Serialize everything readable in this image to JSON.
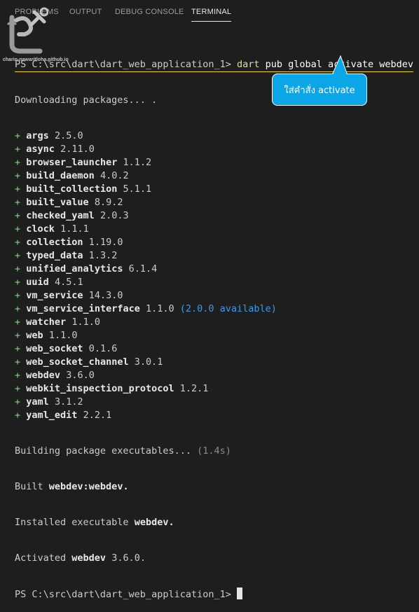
{
  "tabs": [
    {
      "label": "PROBLEMS"
    },
    {
      "label": "OUTPUT"
    },
    {
      "label": "DEBUG CONSOLE"
    },
    {
      "label": "TERMINAL",
      "active": true
    }
  ],
  "watermark": {
    "caption": "charin-nawaritloha.github.io"
  },
  "terminal": {
    "prompt": "PS C:\\src\\dart\\dart_web_application_1>",
    "command_dart": "dart",
    "command_rest": "pub global activate webdev",
    "downloading": "Downloading packages... .",
    "plus": "+",
    "packages": [
      {
        "name": "args",
        "version": "2.5.0"
      },
      {
        "name": "async",
        "version": "2.11.0"
      },
      {
        "name": "browser_launcher",
        "version": "1.1.2"
      },
      {
        "name": "build_daemon",
        "version": "4.0.2"
      },
      {
        "name": "built_collection",
        "version": "5.1.1"
      },
      {
        "name": "built_value",
        "version": "8.9.2"
      },
      {
        "name": "checked_yaml",
        "version": "2.0.3"
      },
      {
        "name": "clock",
        "version": "1.1.1"
      },
      {
        "name": "collection",
        "version": "1.19.0"
      },
      {
        "name": "typed_data",
        "version": "1.3.2"
      },
      {
        "name": "unified_analytics",
        "version": "6.1.4"
      },
      {
        "name": "uuid",
        "version": "4.5.1"
      },
      {
        "name": "vm_service",
        "version": "14.3.0"
      },
      {
        "name": "vm_service_interface",
        "version": "1.1.0",
        "note": "(2.0.0 available)"
      },
      {
        "name": "watcher",
        "version": "1.1.0"
      },
      {
        "name": "web",
        "version": "1.1.0"
      },
      {
        "name": "web_socket",
        "version": "0.1.6"
      },
      {
        "name": "web_socket_channel",
        "version": "3.0.1"
      },
      {
        "name": "webdev",
        "version": "3.6.0"
      },
      {
        "name": "webkit_inspection_protocol",
        "version": "1.2.1"
      },
      {
        "name": "yaml",
        "version": "3.1.2"
      },
      {
        "name": "yaml_edit",
        "version": "2.2.1"
      }
    ],
    "building": "Building package executables...",
    "building_time": "(1.4s)",
    "built_prefix": "Built",
    "built_target": "webdev:webdev.",
    "installed_prefix": "Installed executable",
    "installed_target": "webdev.",
    "activated_prefix": "Activated",
    "activated_target": "webdev",
    "activated_suffix": "3.6.0."
  },
  "callout": {
    "text": "ใส่คำสั่ง activate"
  }
}
